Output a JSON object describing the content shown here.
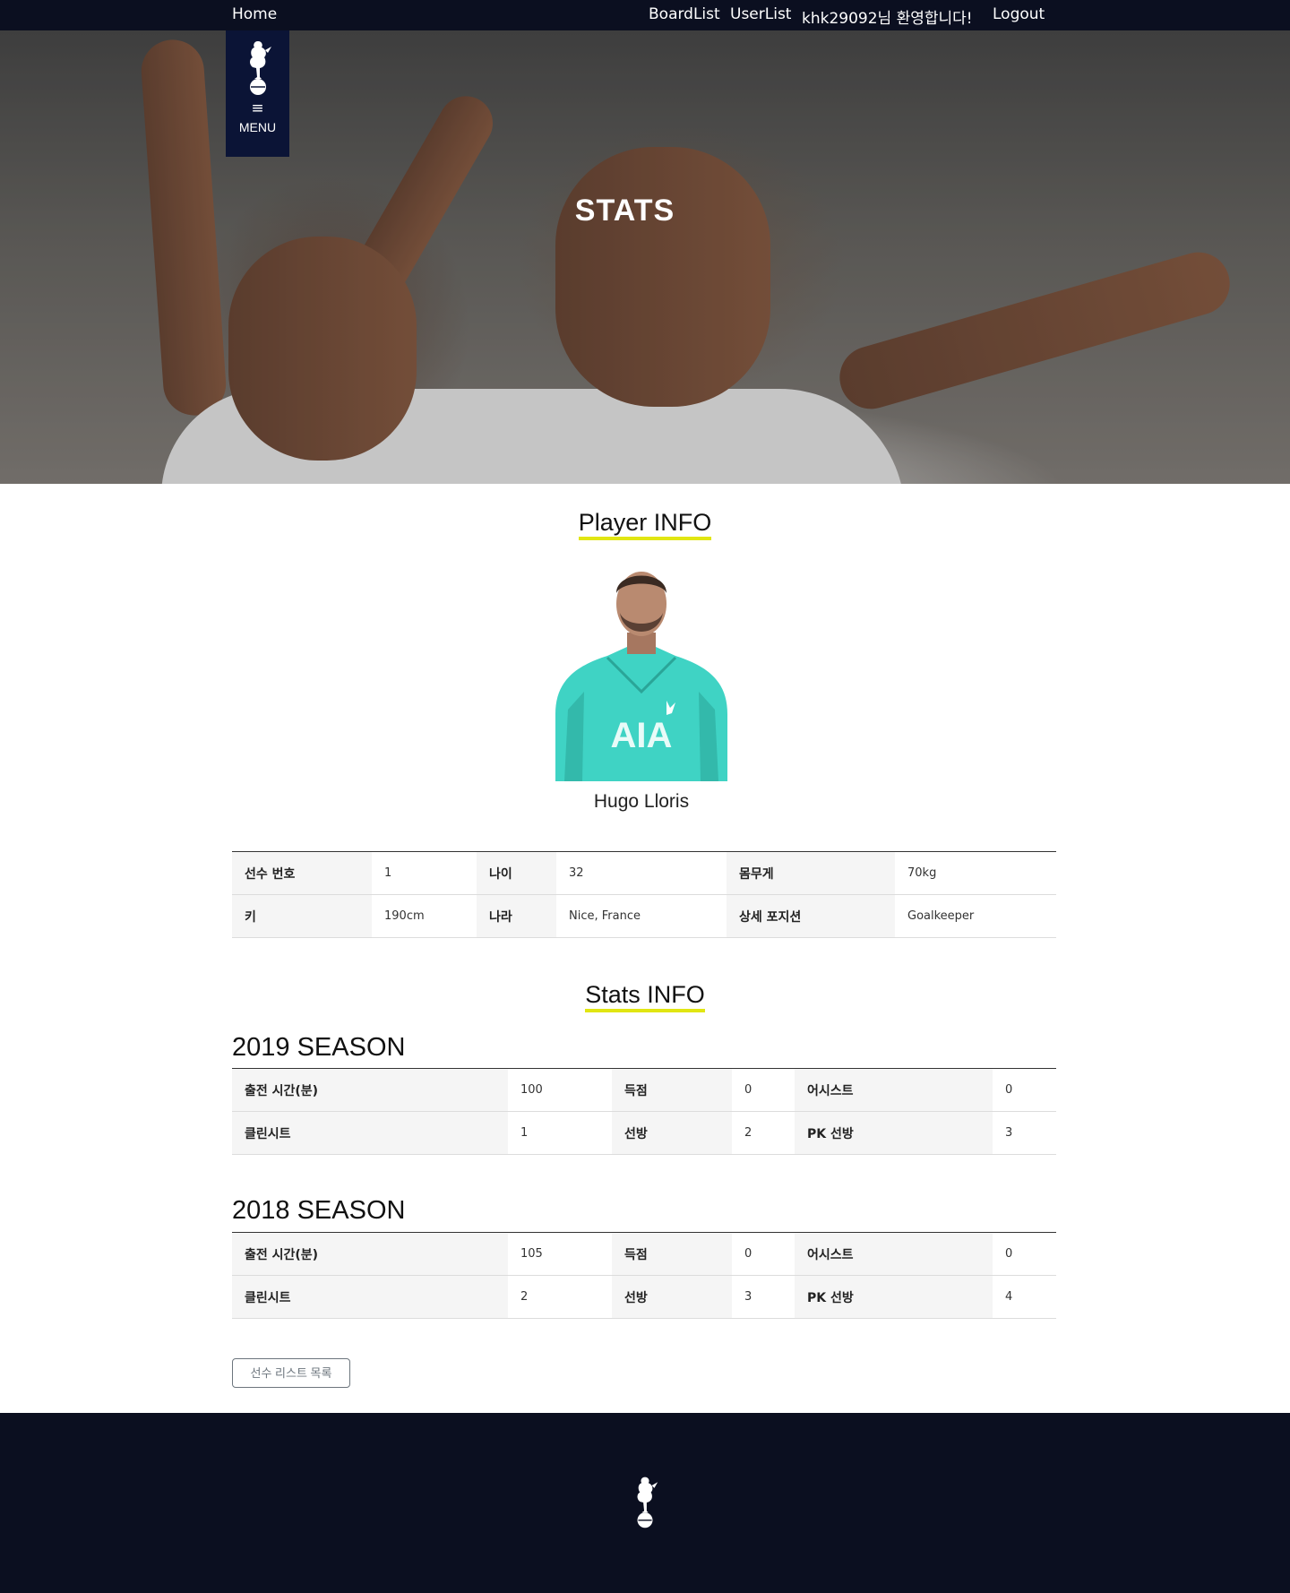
{
  "nav": {
    "home": "Home",
    "board_list": "BoardList",
    "user_list": "UserList",
    "welcome": "khk29092님 환영합니다!",
    "logout": "Logout"
  },
  "menu": {
    "icon": "hamburger-icon",
    "glyph": "≡",
    "label": "MENU"
  },
  "hero": {
    "title": "STATS"
  },
  "player_section": {
    "title": "Player INFO",
    "name": "Hugo Lloris",
    "photo_shirt_text": "AIA"
  },
  "player_info": {
    "rows": [
      [
        {
          "label": "선수 번호",
          "value": "1"
        },
        {
          "label": "나이",
          "value": "32"
        },
        {
          "label": "몸무게",
          "value": "70kg"
        }
      ],
      [
        {
          "label": "키",
          "value": "190cm"
        },
        {
          "label": "나라",
          "value": "Nice, France"
        },
        {
          "label": "상세 포지션",
          "value": "Goalkeeper"
        }
      ]
    ]
  },
  "stats_section": {
    "title": "Stats INFO",
    "seasons": [
      {
        "title": "2019 SEASON",
        "rows": [
          [
            {
              "label": "출전 시간(분)",
              "value": "100"
            },
            {
              "label": "득점",
              "value": "0"
            },
            {
              "label": "어시스트",
              "value": "0"
            }
          ],
          [
            {
              "label": "클린시트",
              "value": "1"
            },
            {
              "label": "선방",
              "value": "2"
            },
            {
              "label": "PK 선방",
              "value": "3"
            }
          ]
        ]
      },
      {
        "title": "2018 SEASON",
        "rows": [
          [
            {
              "label": "출전 시간(분)",
              "value": "105"
            },
            {
              "label": "득점",
              "value": "0"
            },
            {
              "label": "어시스트",
              "value": "0"
            }
          ],
          [
            {
              "label": "클린시트",
              "value": "2"
            },
            {
              "label": "선방",
              "value": "3"
            },
            {
              "label": "PK 선방",
              "value": "4"
            }
          ]
        ]
      }
    ]
  },
  "buttons": {
    "player_list": "선수 리스트 목록"
  },
  "colors": {
    "navy": "#0b0f20",
    "menu_navy": "#0b1436",
    "accent_yellow": "#e1e612",
    "shirt_teal": "#3fd3c4"
  },
  "icons": {
    "club_crest": "cockerel-crest-icon"
  }
}
